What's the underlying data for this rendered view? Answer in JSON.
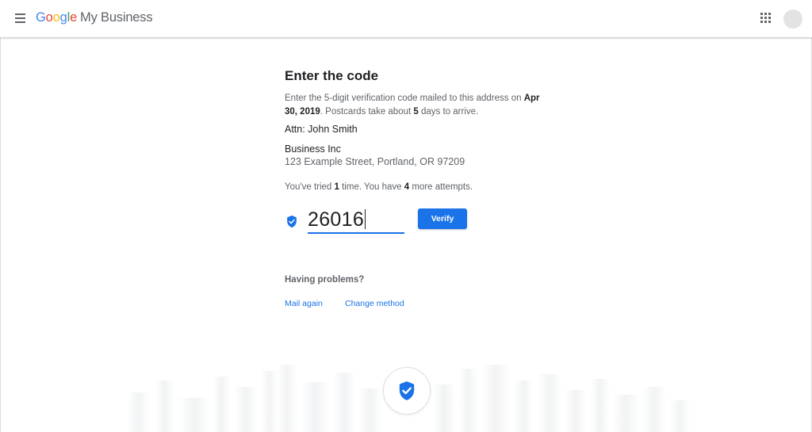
{
  "header": {
    "logo": {
      "g1": "G",
      "g2": "o",
      "g3": "o",
      "g4": "g",
      "g5": "l",
      "g6": "e",
      "product": "My Business"
    },
    "colors": {
      "blue": "#4285f4",
      "red": "#ea4335",
      "yellow": "#fbbc05",
      "green": "#34a853"
    }
  },
  "main": {
    "title": "Enter the code",
    "description": {
      "part1": "Enter the 5-digit verification code mailed to this address on ",
      "date": "Apr 30, 2019",
      "part2": ". Postcards take about ",
      "days": "5",
      "part3": " days to arrive."
    },
    "attn": "Attn: John Smith",
    "business_name": "Business Inc",
    "business_address": "123 Example Street, Portland, OR 97209",
    "attempts": {
      "part1": "You've tried ",
      "tried": "1",
      "part2": " time. You have ",
      "remaining": "4",
      "part3": " more attempts."
    },
    "code_value": "26016",
    "verify_label": "Verify",
    "problems_heading": "Having problems?",
    "mail_again_label": "Mail again",
    "change_method_label": "Change method"
  },
  "icons": {
    "menu": "menu-icon",
    "apps": "apps-grid-icon",
    "avatar": "avatar",
    "verified": "verified-shield-icon"
  },
  "theme": {
    "accent": "#1a73e8",
    "text": "#202124",
    "secondary_text": "#5f6368"
  }
}
